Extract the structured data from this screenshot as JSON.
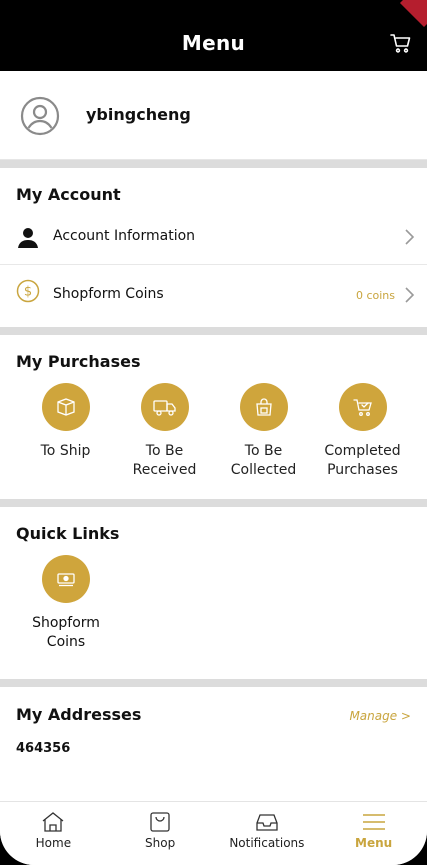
{
  "header": {
    "title": "Menu",
    "cart_icon": "cart-icon"
  },
  "profile": {
    "username": "ybingcheng",
    "avatar_icon": "user-circle-icon"
  },
  "my_account": {
    "title": "My Account",
    "items": [
      {
        "label": "Account Information",
        "icon": "person-icon"
      },
      {
        "label": "Shopform Coins",
        "icon": "dollar-coin-icon",
        "value": "0 coins"
      }
    ]
  },
  "my_purchases": {
    "title": "My Purchases",
    "items": [
      {
        "label": "To Ship",
        "icon": "box-icon"
      },
      {
        "label": "To Be\nReceived",
        "icon": "truck-icon"
      },
      {
        "label": "To Be\nCollected",
        "icon": "store-bag-icon"
      },
      {
        "label": "Completed\nPurchases",
        "icon": "cart-check-icon"
      }
    ]
  },
  "quick_links": {
    "title": "Quick Links",
    "items": [
      {
        "label": "Shopform\nCoins",
        "icon": "cash-icon"
      }
    ]
  },
  "my_addresses": {
    "title": "My Addresses",
    "manage_label": "Manage >",
    "first_code": "464356"
  },
  "bottom_nav": {
    "items": [
      {
        "label": "Home",
        "icon": "home-icon"
      },
      {
        "label": "Shop",
        "icon": "shopping-bag-icon"
      },
      {
        "label": "Notifications",
        "icon": "inbox-icon"
      },
      {
        "label": "Menu",
        "icon": "hamburger-icon",
        "active": true
      }
    ]
  },
  "colors": {
    "accent": "#cfa53c",
    "accent_text": "#c9a53e",
    "header_bg": "#000000",
    "separator": "#dcdcdc"
  }
}
